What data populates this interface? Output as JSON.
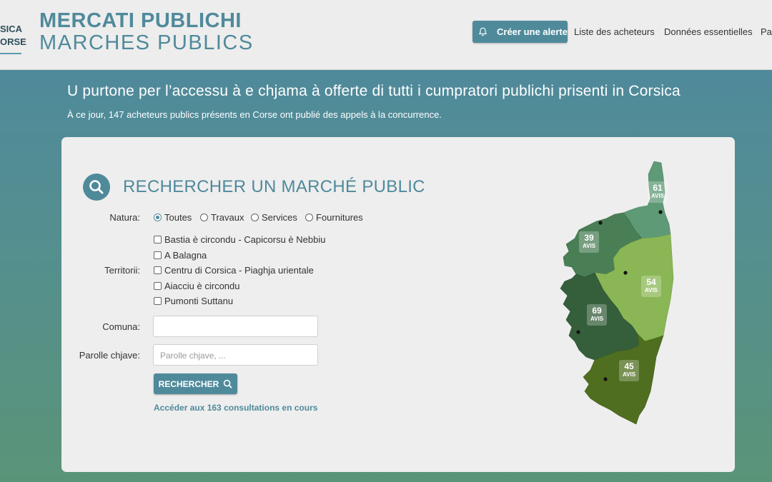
{
  "header": {
    "left_logo_line1": "SICA",
    "left_logo_line2": "ORSE",
    "logo_line1": "MERCATI PUBLICHI",
    "logo_line2": "MARCHES PUBLICS",
    "nav": {
      "alert_button": "Créer une alerte",
      "links": [
        "Liste des acheteurs",
        "Données essentielles",
        "Pa"
      ]
    }
  },
  "hero": {
    "title": "U purtone per l’accessu à e chjama à offerte di tutti i cumpratori publichi prisenti in Corsica",
    "subtitle": "À ce jour, 147 acheteurs publics présents en Corse ont publié des appels à la concurrence."
  },
  "search": {
    "title": "RECHERCHER UN MARCHÉ PUBLIC",
    "natura_label": "Natura:",
    "natura_options": [
      {
        "label": "Toutes",
        "selected": true
      },
      {
        "label": "Travaux",
        "selected": false
      },
      {
        "label": "Services",
        "selected": false
      },
      {
        "label": "Fournitures",
        "selected": false
      }
    ],
    "territorii_label": "Territorii:",
    "territorii_options": [
      "Bastia è circondu - Capicorsu è Nebbiu",
      "A Balagna",
      "Centru di Corsica - Piaghja urientale",
      "Aiacciu è circondu",
      "Pumonti Suttanu"
    ],
    "comuna_label": "Comuna:",
    "comuna_value": "",
    "keywords_label": "Parolle chjave:",
    "keywords_placeholder": "Parolle chjave, ...",
    "button": "RECHERCHER",
    "consultations_link": "Accéder aux 163 consultations en cours"
  },
  "map": {
    "regions": [
      {
        "name": "Bastia è circondu - Capicorsu è Nebbiu",
        "count": "61",
        "unit": "AVIS",
        "color": "#5e9a76"
      },
      {
        "name": "A Balagna",
        "count": "39",
        "unit": "AVIS",
        "color": "#4a7f56"
      },
      {
        "name": "Centru di Corsica - Piaghja urientale",
        "count": "54",
        "unit": "AVIS",
        "color": "#8ab655"
      },
      {
        "name": "Aiacciu è circondu",
        "count": "69",
        "unit": "AVIS",
        "color": "#355e3b"
      },
      {
        "name": "Pumonti Suttanu",
        "count": "45",
        "unit": "AVIS",
        "color": "#4f6e1f"
      }
    ]
  },
  "colors": {
    "brand": "#4f8a9b",
    "hero_bottom": "#5a9478"
  }
}
